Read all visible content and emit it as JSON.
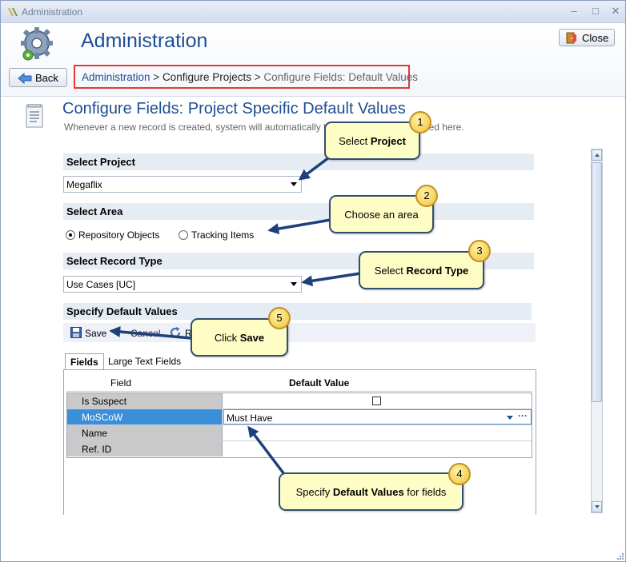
{
  "window": {
    "title": "Administration",
    "controls": {
      "minimize": "–",
      "maximize": "□",
      "close": "✕"
    }
  },
  "header": {
    "title": "Administration",
    "close_label": "Close",
    "back_label": "Back"
  },
  "breadcrumb": {
    "link": "Administration",
    "sep1": " > ",
    "middle": "Configure Projects",
    "sep2": " > ",
    "current": "Configure Fields: Default Values"
  },
  "section": {
    "title": "Configure Fields: Project Specific Default Values",
    "description": "Whenever a new record is created, system will automatically the default values specified here."
  },
  "select_project": {
    "label": "Select Project",
    "value": "Megaflix"
  },
  "select_area": {
    "label": "Select Area",
    "options": [
      {
        "label": "Repository Objects",
        "selected": true
      },
      {
        "label": "Tracking Items",
        "selected": false
      }
    ]
  },
  "select_record_type": {
    "label": "Select Record Type",
    "value": "Use Cases [UC]"
  },
  "specify_defaults": {
    "label": "Specify Default Values"
  },
  "toolbar": {
    "save": "Save",
    "cancel": "Cancel",
    "reset": "R"
  },
  "tabs": [
    {
      "label": "Fields",
      "active": true
    },
    {
      "label": "Large Text Fields",
      "active": false
    }
  ],
  "grid": {
    "columns": [
      "Field",
      "Default Value"
    ],
    "rows": [
      {
        "field": "Is Suspect",
        "value": "",
        "type": "checkbox",
        "checked": false
      },
      {
        "field": "MoSCoW",
        "value": "Must Have",
        "type": "select",
        "selected": true
      },
      {
        "field": "Name",
        "value": "",
        "type": "text"
      },
      {
        "field": "Ref. ID",
        "value": "",
        "type": "text"
      }
    ]
  },
  "callouts": [
    {
      "number": "1",
      "pre": "Select ",
      "bold": "Project",
      "post": ""
    },
    {
      "number": "2",
      "pre": "Choose an area",
      "bold": "",
      "post": ""
    },
    {
      "number": "3",
      "pre": "Select ",
      "bold": "Record Type",
      "post": ""
    },
    {
      "number": "4",
      "pre": "Specify ",
      "bold": "Default Values",
      "post": " for fields"
    },
    {
      "number": "5",
      "pre": "Click ",
      "bold": "Save",
      "post": ""
    }
  ],
  "colors": {
    "accent_blue": "#1f4e93",
    "callout_fill": "#fffdc6",
    "callout_border": "#2f4f6f",
    "badge_fill": "#f2c232",
    "breadcrumb_border": "#e53939",
    "selected_row": "#3b8fd9"
  }
}
